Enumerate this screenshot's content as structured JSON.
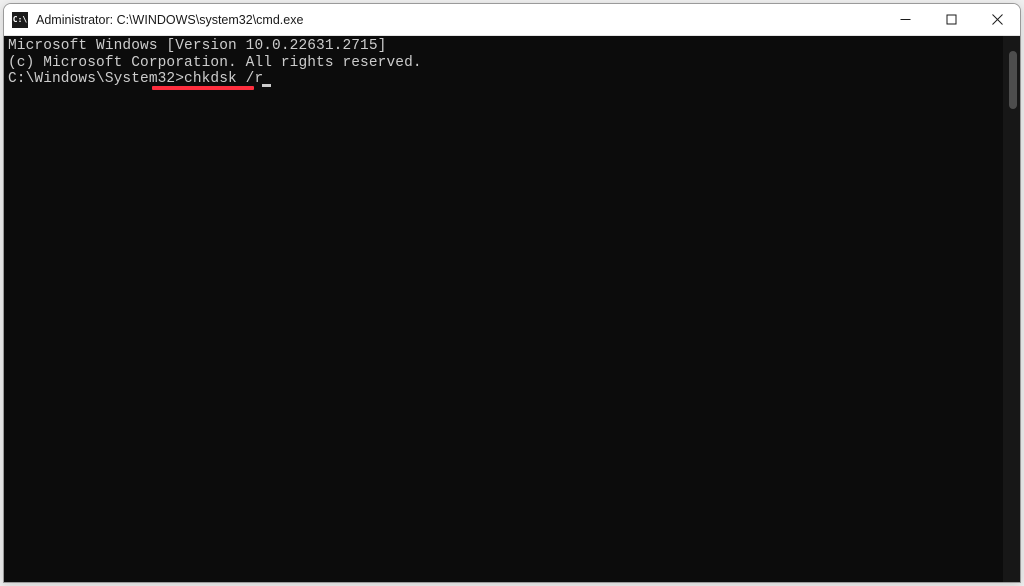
{
  "titlebar": {
    "icon_label": "C:\\",
    "title": "Administrator: C:\\WINDOWS\\system32\\cmd.exe"
  },
  "terminal": {
    "line1": "Microsoft Windows [Version 10.0.22631.2715]",
    "line2": "(c) Microsoft Corporation. All rights reserved.",
    "blank": "",
    "prompt": "C:\\Windows\\System32>",
    "command": "chkdsk /r"
  },
  "annotation": {
    "underline_target": "chkdsk /r",
    "color": "#ff2e3e"
  }
}
